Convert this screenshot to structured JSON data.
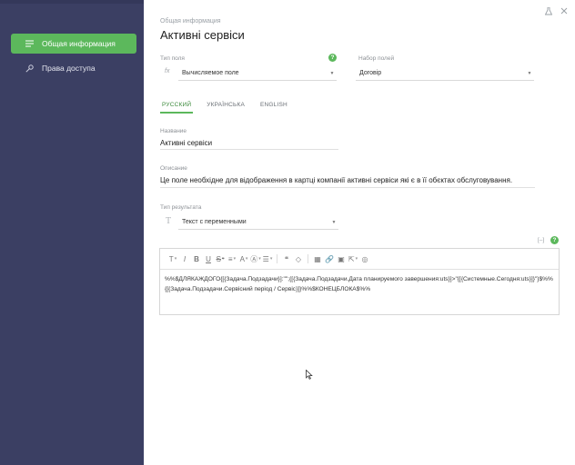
{
  "sidebar": {
    "items": [
      {
        "label": "Общая информация",
        "icon": "list-icon",
        "active": true
      },
      {
        "label": "Права доступа",
        "icon": "key-icon",
        "active": false
      }
    ]
  },
  "header": {
    "breadcrumb": "Общая информация",
    "title": "Активні сервіси"
  },
  "form": {
    "field_type": {
      "label": "Тип поля",
      "prefix": "fx",
      "value": "Вычисляемое поле"
    },
    "field_set": {
      "label": "Набор полей",
      "value": "Договір"
    },
    "help_glyph": "?",
    "tabs": [
      "РУССКИЙ",
      "УКРАЇНСЬКА",
      "ENGLISH"
    ],
    "name": {
      "label": "Название",
      "value": "Активні сервіси"
    },
    "description": {
      "label": "Описание",
      "value": "Це поле необхідне для відображення в картці компанії активні сервіси які є в її обєктах обслуговування."
    },
    "result_type": {
      "label": "Тип результата",
      "value": "Текст с переменными"
    },
    "expand_label": "[–]",
    "editor": {
      "toolbar": [
        "T",
        "I",
        "B",
        "U",
        "S",
        "≡",
        "A",
        "Ⓐ",
        "☰",
        "❝",
        "◇",
        "▦",
        "🔗",
        "▣",
        "⇱",
        "◎"
      ],
      "content": "%%$ДЛЯКАЖДОГО{[{Задача.Подзадачи}]:\"\";{[{Задача.Подзадачи.Дата планируемого завершения:uts}]>\"{[{Системные.Сегодня:uts}]}\"}$%%{[{Задача.Подзадачи.Сервісний період / Сервіс}]}%%$КОНЕЦБЛОКА$%%"
    }
  },
  "colors": {
    "accent": "#5cb85c",
    "sidebar": "#3b3f63"
  }
}
